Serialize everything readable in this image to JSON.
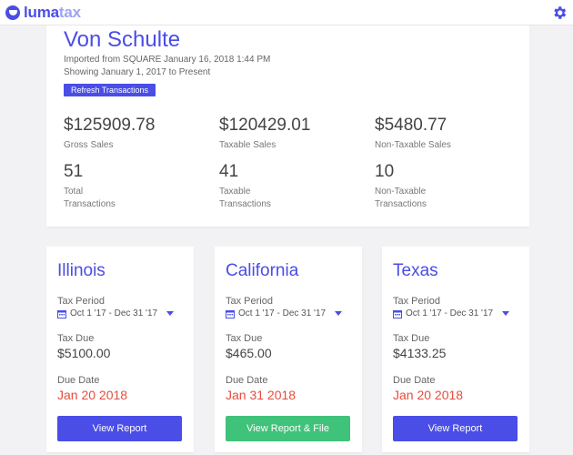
{
  "app": {
    "logo_main": "luma",
    "logo_suffix": "tax"
  },
  "summary": {
    "client_name": "Von Schulte",
    "imported_text": "Imported from SQUARE January 16, 2018 1:44 PM",
    "showing_text": "Showing January 1, 2017 to Present",
    "refresh_label": "Refresh Transactions",
    "stats": [
      {
        "value": "$125909.78",
        "label": "Gross Sales"
      },
      {
        "value": "$120429.01",
        "label": "Taxable Sales"
      },
      {
        "value": "$5480.77",
        "label": "Non-Taxable Sales"
      },
      {
        "value": "51",
        "label": "Total\nTransactions"
      },
      {
        "value": "41",
        "label": "Taxable\nTransactions"
      },
      {
        "value": "10",
        "label": "Non-Taxable\nTransactions"
      }
    ]
  },
  "states": [
    {
      "name": "Illinois",
      "tax_period_label": "Tax Period",
      "period": "Oct 1 '17 - Dec 31 '17",
      "tax_due_label": "Tax Due",
      "tax_due": "$5100.00",
      "due_date_label": "Due Date",
      "due_date": "Jan 20 2018",
      "button_label": "View Report",
      "button_color": "#4a4de6"
    },
    {
      "name": "California",
      "tax_period_label": "Tax Period",
      "period": "Oct 1 '17 - Dec 31 '17",
      "tax_due_label": "Tax Due",
      "tax_due": "$465.00",
      "due_date_label": "Due Date",
      "due_date": "Jan 31 2018",
      "button_label": "View Report & File",
      "button_color": "#3fc27a"
    },
    {
      "name": "Texas",
      "tax_period_label": "Tax Period",
      "period": "Oct 1 '17 - Dec 31 '17",
      "tax_due_label": "Tax Due",
      "tax_due": "$4133.25",
      "due_date_label": "Due Date",
      "due_date": "Jan 20 2018",
      "button_label": "View Report",
      "button_color": "#4a4de6"
    }
  ],
  "colors": {
    "accent": "#4a4de6",
    "success": "#3fc27a",
    "danger": "#e74c3c"
  }
}
